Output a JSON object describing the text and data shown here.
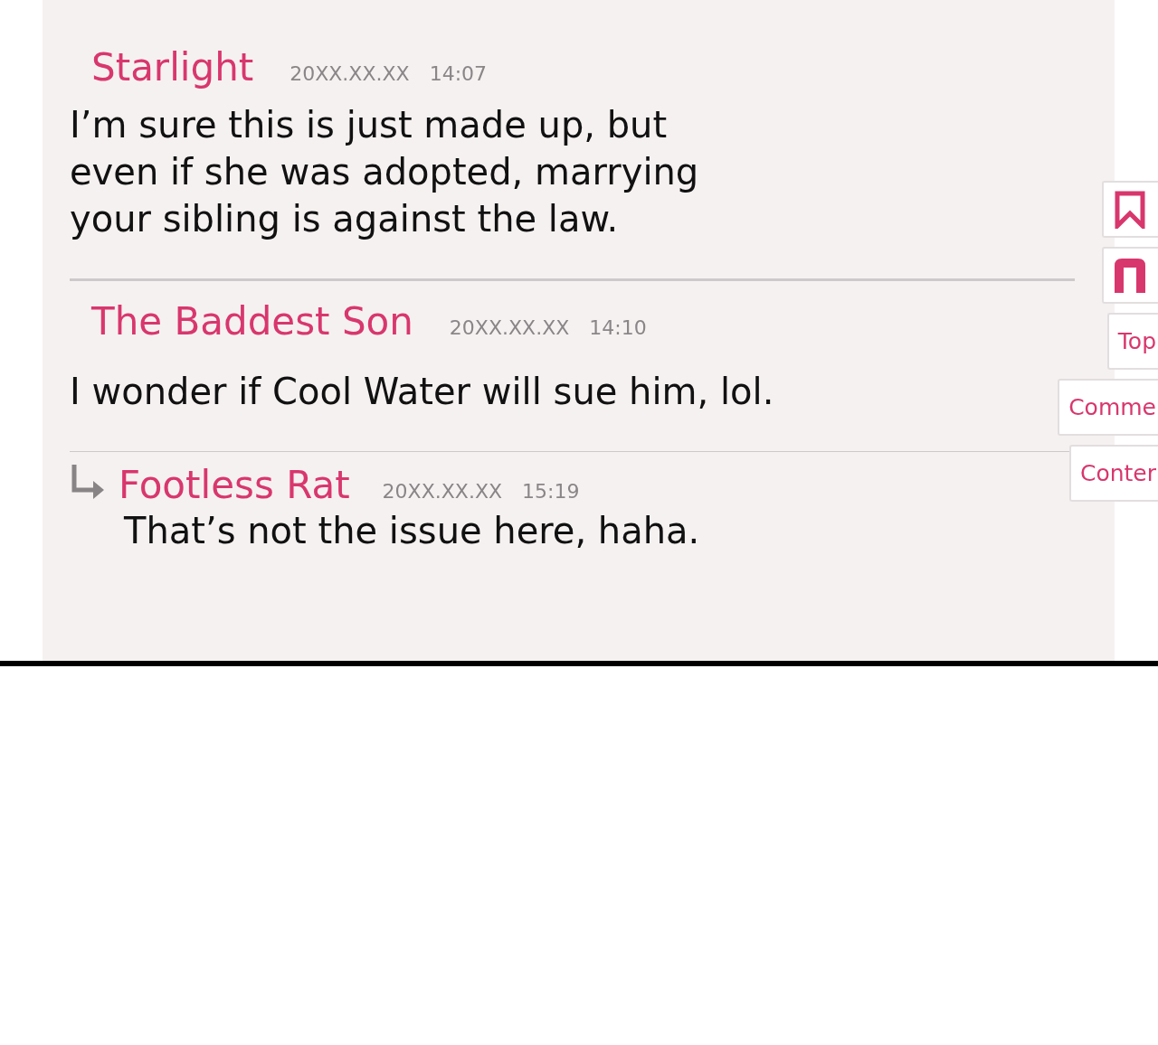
{
  "comments": [
    {
      "kind": "comment",
      "author": "Starlight",
      "date": "20XX.XX.XX",
      "time": "14:07",
      "lines": [
        "I’m sure this is just made up, but",
        "even if she was adopted, marrying",
        "your sibling is against the law."
      ]
    },
    {
      "kind": "comment",
      "author": "The Baddest Son",
      "date": "20XX.XX.XX",
      "time": "14:10",
      "lines": [
        "I wonder if Cool Water will sue him, lol."
      ]
    },
    {
      "kind": "reply",
      "author": "Footless Rat",
      "date": "20XX.XX.XX",
      "time": "15:19",
      "lines": [
        "That’s not the issue here, haha."
      ]
    }
  ],
  "side_buttons": [
    {
      "kind": "bookmark"
    },
    {
      "kind": "logo"
    },
    {
      "kind": "text",
      "label": "Top"
    },
    {
      "kind": "text",
      "label": "Comme"
    },
    {
      "kind": "text",
      "label": "Conter"
    }
  ]
}
